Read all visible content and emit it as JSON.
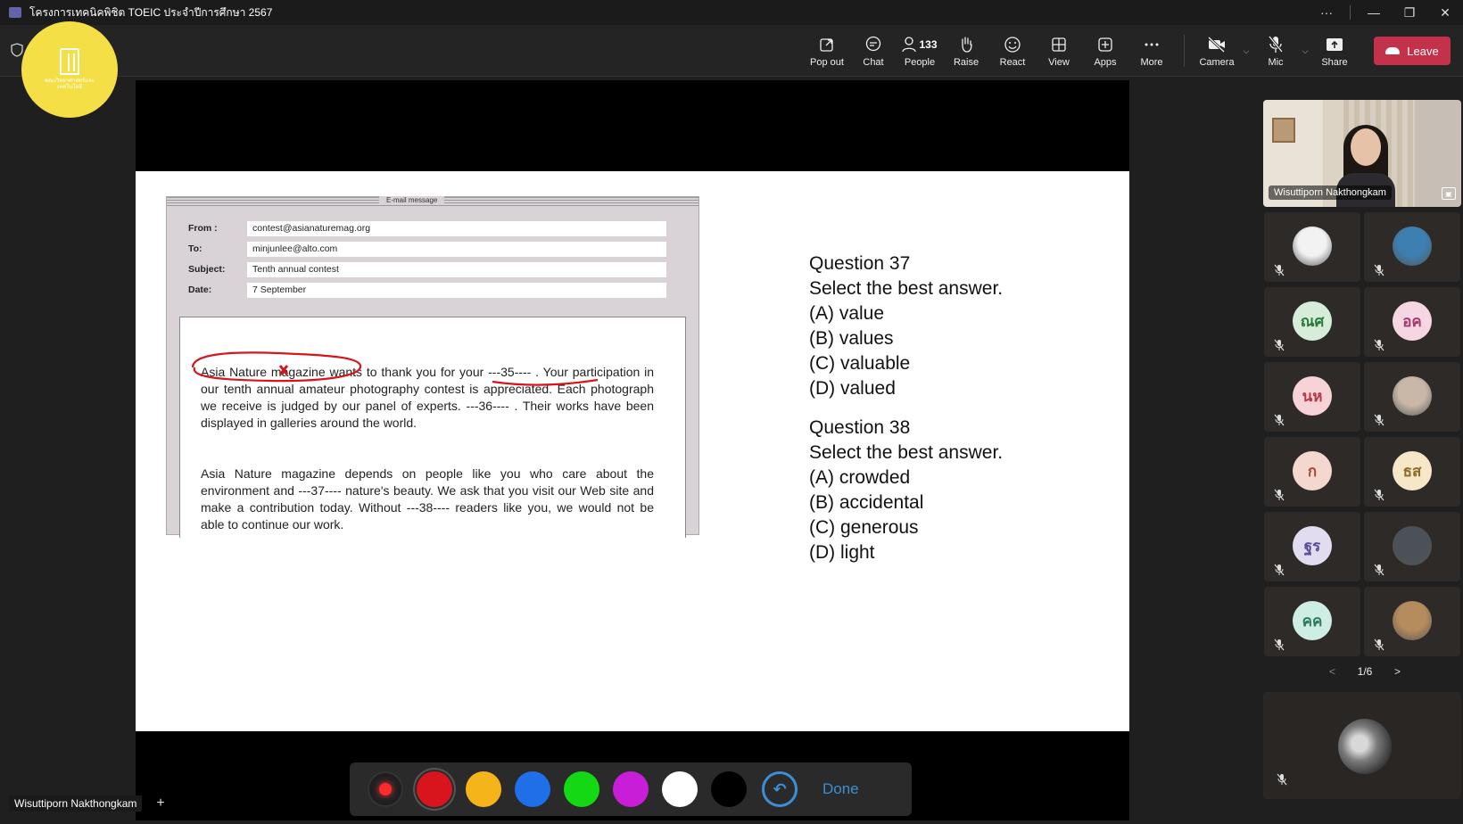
{
  "window": {
    "title": "โครงการเทคนิคพิชิต TOEIC ประจำปีการศึกษา 2567",
    "controls": [
      "···",
      "—",
      "❐",
      "✕"
    ]
  },
  "toolbar": {
    "popout": "Pop out",
    "chat": "Chat",
    "people": "People",
    "people_count": "133",
    "raise": "Raise",
    "react": "React",
    "view": "View",
    "apps": "Apps",
    "more": "More",
    "camera": "Camera",
    "mic": "Mic",
    "share": "Share",
    "leave": "Leave"
  },
  "badge": {
    "text": "คณะวิทยาศาสตร์และเทคโนโลยี"
  },
  "slide": {
    "email": {
      "header": "E-mail message",
      "fields": [
        {
          "label": "From :",
          "value": "contest@asianaturemag.org"
        },
        {
          "label": "To:",
          "value": "minjunlee@alto.com"
        },
        {
          "label": "Subject:",
          "value": "Tenth annual contest"
        },
        {
          "label": "Date:",
          "value": "7 September"
        }
      ],
      "p1": "Asia Nature magazine wants to thank you for your ---35---- . Your participation in our tenth annual amateur photography contest is appreciated. Each photograph we receive is judged by our panel of experts. ---36---- . Their works have been displayed in galleries around the world.",
      "p2": "Asia Nature magazine depends on people like you who care about the environment and ---37---- nature's beauty. We ask that you visit our Web site and make a contribution today. Without ---38---- readers like you, we would not be able to continue our work."
    },
    "questions": [
      {
        "title": "Question 37",
        "prompt": "Select the best answer.",
        "options": [
          "(A) value",
          "(B) values",
          "(C) valuable",
          "(D) valued"
        ]
      },
      {
        "title": "Question 38",
        "prompt": "Select the best answer.",
        "options": [
          "(A) crowded",
          "(B) accidental",
          "(C) generous",
          "(D) light"
        ]
      }
    ]
  },
  "ink": {
    "colors": [
      "#d8141c",
      "#f4b41a",
      "#1e6fe8",
      "#15d815",
      "#c81ed8",
      "#ffffff",
      "#000000"
    ],
    "done": "Done"
  },
  "presenter": {
    "name": "Wisuttiporn Nakthongkam"
  },
  "participants": {
    "main": {
      "name": "Wisuttiporn Nakthongkam"
    },
    "tiles": [
      {
        "initials": "",
        "bg": "#f2f2f2",
        "kind": "photo-child"
      },
      {
        "initials": "",
        "bg": "#3d7fb0",
        "kind": "photo-colorful"
      },
      {
        "initials": "ณศ",
        "bg": "#d6eed9",
        "fg": "#2c7a3a"
      },
      {
        "initials": "อค",
        "bg": "#f7d6e4",
        "fg": "#a33a6b"
      },
      {
        "initials": "นห",
        "bg": "#f7d2d6",
        "fg": "#b33a45"
      },
      {
        "initials": "",
        "bg": "#c9b7a8",
        "kind": "photo-person"
      },
      {
        "initials": "ก",
        "bg": "#f4d7cf",
        "fg": "#a3493a"
      },
      {
        "initials": "ธส",
        "bg": "#f6e7c8",
        "fg": "#8a6a25"
      },
      {
        "initials": "ฐร",
        "bg": "#e2dcf0",
        "fg": "#5a4b93"
      },
      {
        "initials": "",
        "bg": "#4a5158",
        "kind": "photo-dark"
      },
      {
        "initials": "คค",
        "bg": "#cfeee3",
        "fg": "#2a7a5c"
      },
      {
        "initials": "",
        "bg": "#b58c5e",
        "kind": "photo-dog"
      }
    ],
    "page": "1/6"
  }
}
